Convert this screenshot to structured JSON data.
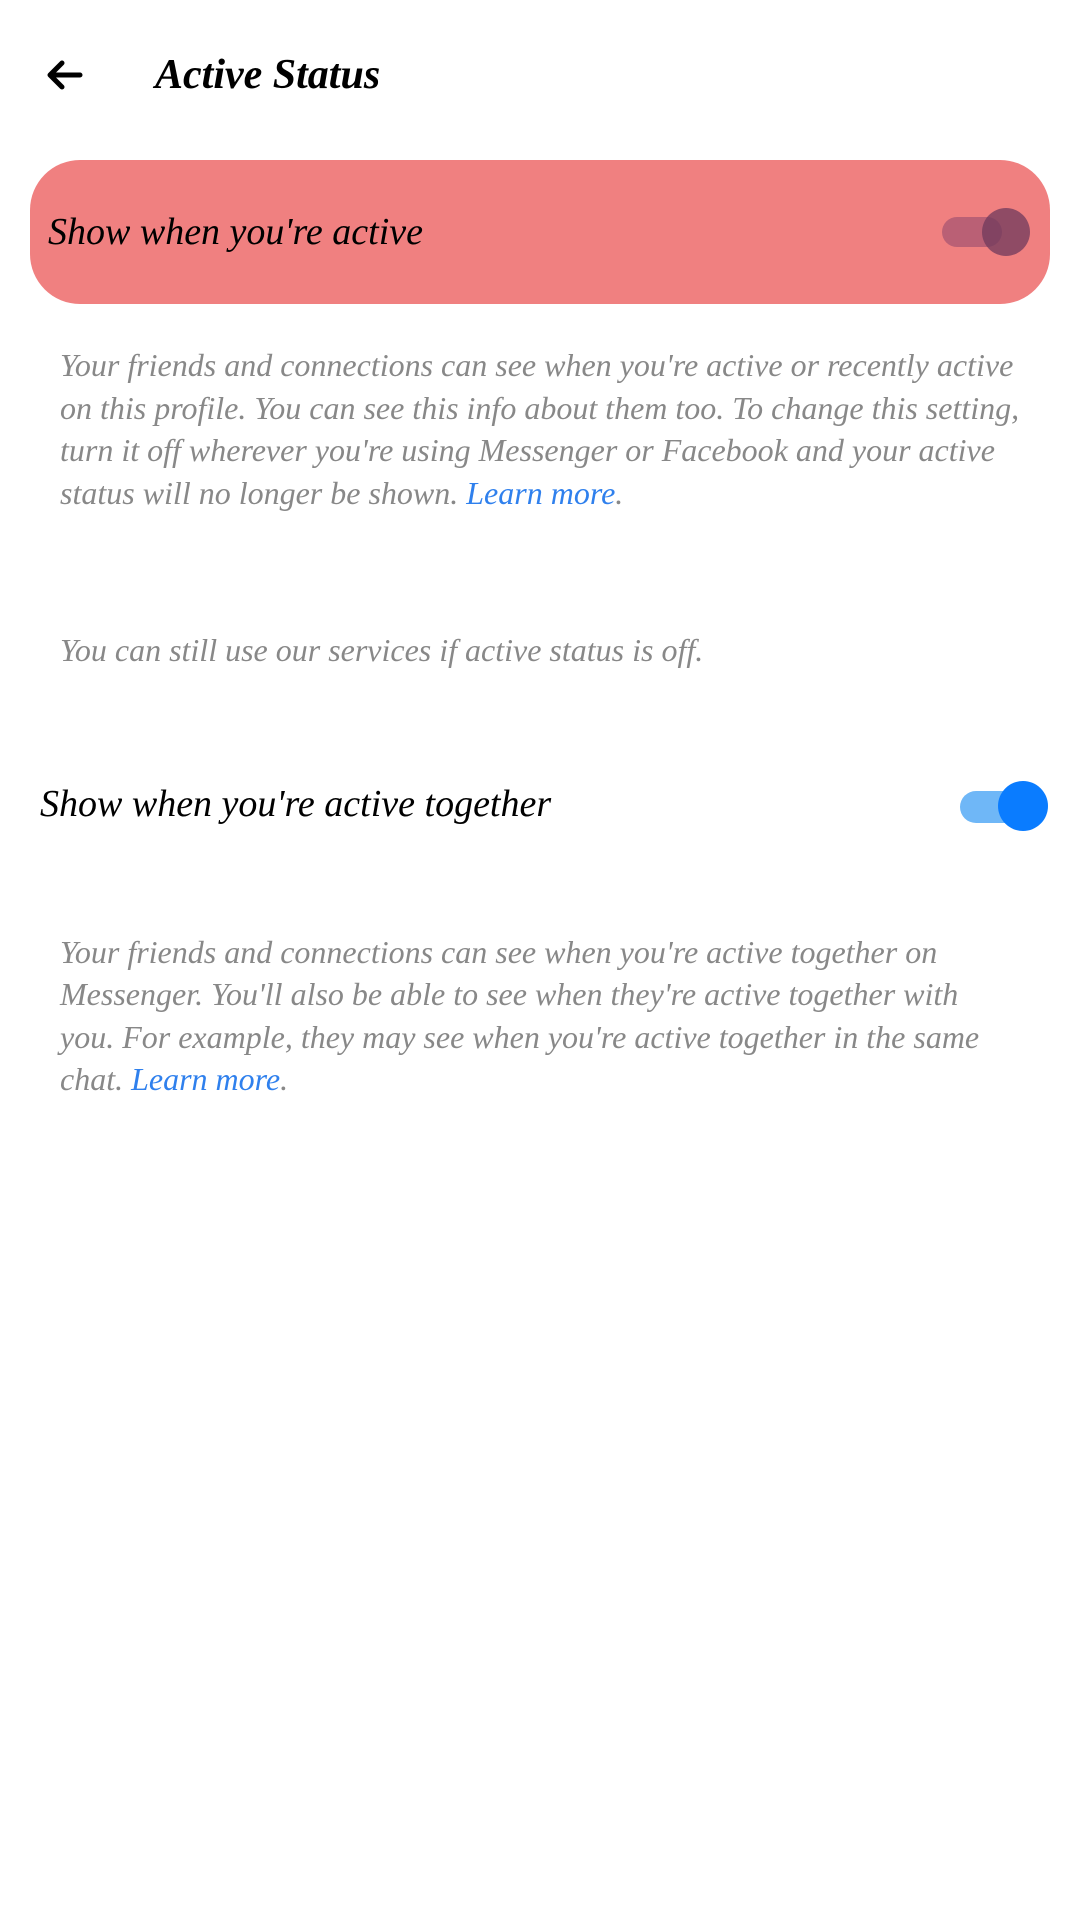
{
  "header": {
    "title": "Active Status"
  },
  "setting1": {
    "label": "Show when you're active",
    "description": "Your friends and connections can see when you're active or recently active on this profile. You can see this info about them too. To change this setting, turn it off wherever you're using Messenger or Facebook and your active status will no longer be shown. ",
    "learn_more": "Learn more",
    "note": "You can still use our services if active status is off."
  },
  "setting2": {
    "label": "Show when you're active together",
    "description": "Your friends and connections can see when you're active together on Messenger. You'll also be able to see when they're active together with you. For example, they may see when you're active together in the same chat. ",
    "learn_more": "Learn more"
  }
}
